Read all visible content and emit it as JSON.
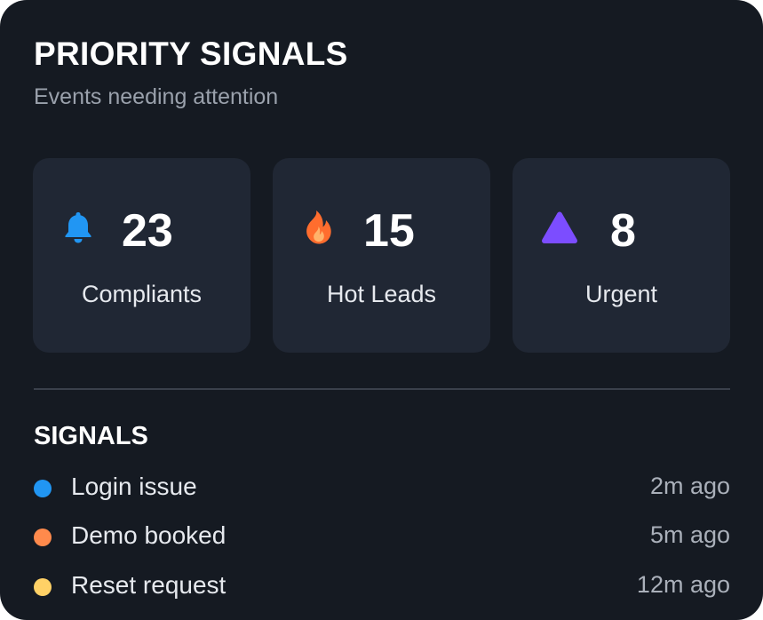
{
  "header": {
    "title": "PRIORITY SIGNALS",
    "subtitle": "Events needing attention"
  },
  "stats": [
    {
      "value": "23",
      "label": "Compliants",
      "icon": "bell-icon",
      "color": "#2196f3"
    },
    {
      "value": "15",
      "label": "Hot Leads",
      "icon": "fire-icon",
      "color": "#ff7a3d"
    },
    {
      "value": "8",
      "label": "Urgent",
      "icon": "triangle-icon",
      "color": "#7c4dff"
    }
  ],
  "signals": {
    "title": "SIGNALS",
    "items": [
      {
        "label": "Login issue",
        "time": "2m ago",
        "color": "#2196f3"
      },
      {
        "label": "Demo booked",
        "time": "5m ago",
        "color": "#ff8a4c"
      },
      {
        "label": "Reset request",
        "time": "12m ago",
        "color": "#ffd166"
      }
    ]
  }
}
